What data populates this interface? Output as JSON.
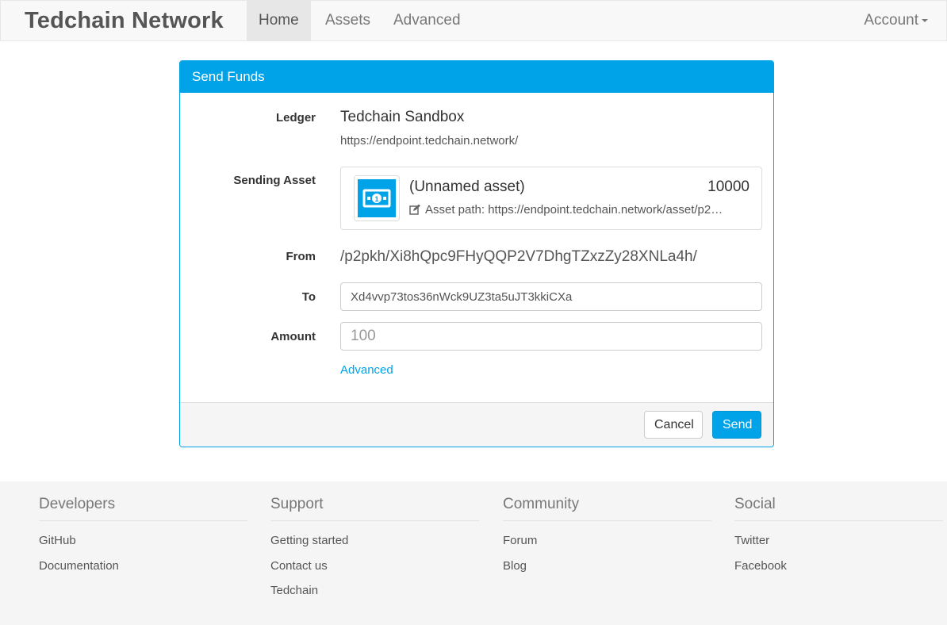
{
  "navbar": {
    "brand": "Tedchain Network",
    "items": [
      {
        "label": "Home",
        "active": true
      },
      {
        "label": "Assets",
        "active": false
      },
      {
        "label": "Advanced",
        "active": false
      }
    ],
    "account": "Account"
  },
  "panel": {
    "title": "Send Funds",
    "ledger_label": "Ledger",
    "ledger_name": "Tedchain Sandbox",
    "ledger_url": "https://endpoint.tedchain.network/",
    "sending_asset_label": "Sending Asset",
    "asset": {
      "name": "(Unnamed asset)",
      "amount": "10000",
      "path": "Asset path: https://endpoint.tedchain.network/asset/p2…",
      "icon": "banknote-icon"
    },
    "from_label": "From",
    "from_value": "/p2pkh/Xi8hQpc9FHyQQP2V7DhgTZxzZy28XNLa4h/",
    "to_label": "To",
    "to_value": "Xd4vvp73tos36nWck9UZ3ta5uJT3kkiCXa",
    "amount_label": "Amount",
    "amount_placeholder": "100",
    "advanced_link": "Advanced",
    "cancel_label": "Cancel",
    "send_label": "Send"
  },
  "footer": {
    "columns": [
      {
        "title": "Developers",
        "links": [
          "GitHub",
          "Documentation"
        ]
      },
      {
        "title": "Support",
        "links": [
          "Getting started",
          "Contact us",
          "Tedchain"
        ]
      },
      {
        "title": "Community",
        "links": [
          "Forum",
          "Blog"
        ]
      },
      {
        "title": "Social",
        "links": [
          "Twitter",
          "Facebook"
        ]
      }
    ]
  },
  "colors": {
    "accent": "#00a3e8",
    "navbar_bg": "#f8f8f8",
    "footer_bg": "#f5f5f5"
  }
}
